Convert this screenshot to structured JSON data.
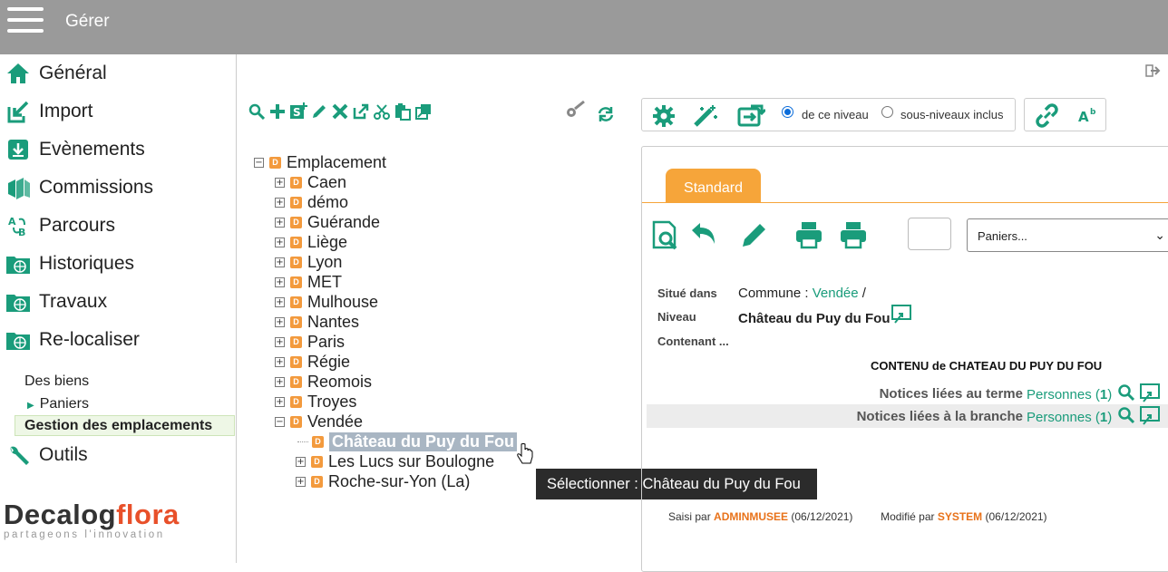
{
  "header": {
    "title": "Gérer"
  },
  "sidebar": {
    "items": [
      {
        "label": "Général",
        "icon": "home-icon"
      },
      {
        "label": "Import",
        "icon": "import-icon"
      },
      {
        "label": "Evènements",
        "icon": "download-box-icon"
      },
      {
        "label": "Commissions",
        "icon": "books-icon"
      },
      {
        "label": "Parcours",
        "icon": "path-ab-icon"
      },
      {
        "label": "Historiques",
        "icon": "folder-globe-icon"
      },
      {
        "label": "Travaux",
        "icon": "folder-globe-icon"
      },
      {
        "label": "Re-localiser",
        "icon": "folder-globe-icon"
      }
    ],
    "sub": {
      "des_biens": "Des biens",
      "paniers": "Paniers",
      "gestion": "Gestion des emplacements"
    },
    "outils": "Outils",
    "logo": {
      "part1": "Decalog",
      "part2": "flora",
      "tagline": "partageons l'innovation"
    }
  },
  "tree": {
    "root": "Emplacement",
    "children": [
      "Caen",
      "démo",
      "Guérande",
      "Liège",
      "Lyon",
      "MET",
      "Mulhouse",
      "Nantes",
      "Paris",
      "Régie",
      "Reomois",
      "Troyes",
      "Vendée"
    ],
    "vendee_children": [
      "Château du Puy du Fou",
      "Les Lucs sur Boulogne",
      "Roche-sur-Yon (La)"
    ],
    "badge": "D"
  },
  "tooltip": "Sélectionner : Château du Puy du Fou",
  "options": {
    "radio1": "de ce niveau",
    "radio2": "sous-niveaux inclus",
    "selected": "radio1"
  },
  "panel": {
    "tab": "Standard",
    "paniers": "Paniers...",
    "situe_label": "Situé dans",
    "situe_prefix": "Commune : ",
    "situe_link": "Vendée",
    "situe_sep": " /",
    "niveau_label": "Niveau",
    "niveau_value": "Château du Puy du Fou",
    "contenant_label": "Contenant ...",
    "contenu_title": "CONTENU de CHATEAU DU PUY DU FOU",
    "notices": [
      {
        "label": "Notices liées au terme",
        "link": "Personnes",
        "count": "1"
      },
      {
        "label": "Notices liées à la branche",
        "link": "Personnes",
        "count": "1"
      }
    ],
    "footer": {
      "saisi_label": "Saisi par ",
      "saisi_user": "ADMINMUSEE",
      "saisi_date": " (06/12/2021)",
      "modif_label": "Modifié par ",
      "modif_user": "SYSTEM",
      "modif_date": " (06/12/2021)"
    }
  },
  "colors": {
    "accent": "#1a9c7b",
    "tab": "#f6a53a",
    "badge": "#f39a3d",
    "topbar": "#9a9a9a"
  }
}
